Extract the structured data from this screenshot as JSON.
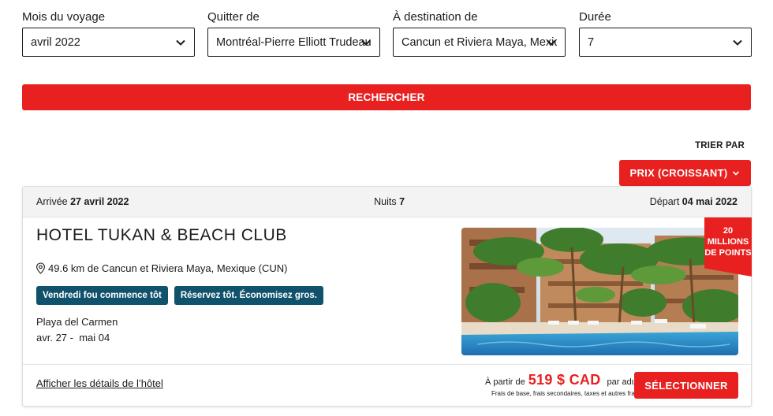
{
  "filters": [
    {
      "label": "Mois du voyage",
      "value": "avril 2022"
    },
    {
      "label": "Quitter de",
      "value": "Montréal-Pierre Elliott Trudeau"
    },
    {
      "label": "À destination de",
      "value": "Cancun et Riviera Maya, Mexique"
    },
    {
      "label": "Durée",
      "value": "7"
    }
  ],
  "search_button": "RECHERCHER",
  "sort": {
    "label": "TRIER PAR",
    "value": "PRIX (CROISSANT)"
  },
  "card": {
    "arrival_label": "Arrivée",
    "arrival_date": "27 avril 2022",
    "nights_label": "Nuits",
    "nights": "7",
    "departure_label": "Départ",
    "departure_date": "04 mai 2022",
    "hotel_name": "HOTEL TUKAN & BEACH CLUB",
    "location": "49.6 km de Cancun et Riviera Maya, Mexique (CUN)",
    "badges": [
      "Vendredi fou commence tôt",
      "Réservez tôt. Économisez gros."
    ],
    "city": "Playa del Carmen",
    "dates": "avr. 27 -  mai 04",
    "ribbon": [
      "20",
      "MILLIONS",
      "DE POINTS"
    ],
    "details_link": "Afficher les détails de l’hôtel",
    "price_prefix": "À partir de",
    "price": "519 $ CAD",
    "price_suffix": "par adulte",
    "price_note": "Frais de base, frais secondaires, taxes et autres frais",
    "select_button": "SÉLECTIONNER"
  },
  "colors": {
    "accent": "#e82020",
    "badge": "#10516b"
  }
}
